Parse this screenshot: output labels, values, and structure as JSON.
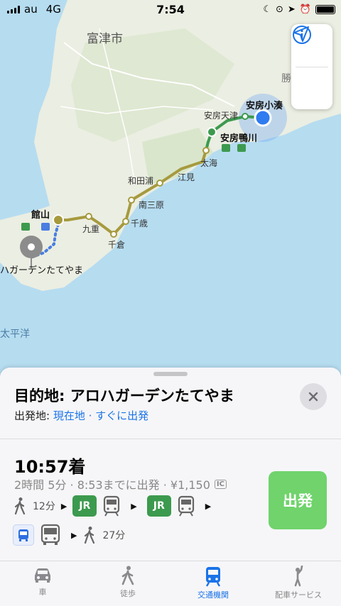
{
  "status_bar": {
    "carrier": "au",
    "network": "4G",
    "time": "7:54"
  },
  "map": {
    "labels": {
      "city_futtsu": "富津市",
      "tateyama": "館山",
      "kokonoe": "九重",
      "chikura": "千倉",
      "chitose": "千歳",
      "minamiboso": "南三原",
      "wadaura": "和田浦",
      "emi": "江見",
      "futomi": "太海",
      "awa_kamogawa": "安房鴨川",
      "awa_amatsu": "安房天津",
      "awa_kominato": "安房小湊",
      "destination": "ハガーデンたてやま",
      "pacific": "太平洋",
      "katsuura": "勝",
      "jr_mark": "JR"
    },
    "colors": {
      "sea": "#b6dcf0",
      "land": "#ebeee2",
      "green_land": "#d4e8c8",
      "train_route": "#a69a3e",
      "bus_route": "#4a7ee0",
      "current_location": "#2f7bf0",
      "station_green": "#3c9a4e"
    },
    "buttons": {
      "info_icon": "info-icon",
      "location_icon": "location-arrow-icon"
    }
  },
  "sheet": {
    "title": "目的地: アロハガーデンたてやま",
    "origin_prefix": "出発地: ",
    "origin_value": "現在地",
    "origin_sep": " · ",
    "origin_depart": "すぐに出発",
    "route": {
      "arrival": "10:57着",
      "summary": "2時間 5分 · 8:53までに出発 · ¥1,150",
      "ic_label": "IC",
      "walk1": "12分",
      "jr_label": "JR",
      "walk2": "27分"
    },
    "go_button": "出発"
  },
  "tabs": [
    {
      "label": "車",
      "icon": "car-icon",
      "active": false
    },
    {
      "label": "徒歩",
      "icon": "walk-icon",
      "active": false
    },
    {
      "label": "交通機関",
      "icon": "train-icon",
      "active": true
    },
    {
      "label": "配車サービス",
      "icon": "ride-hail-icon",
      "active": false
    }
  ]
}
